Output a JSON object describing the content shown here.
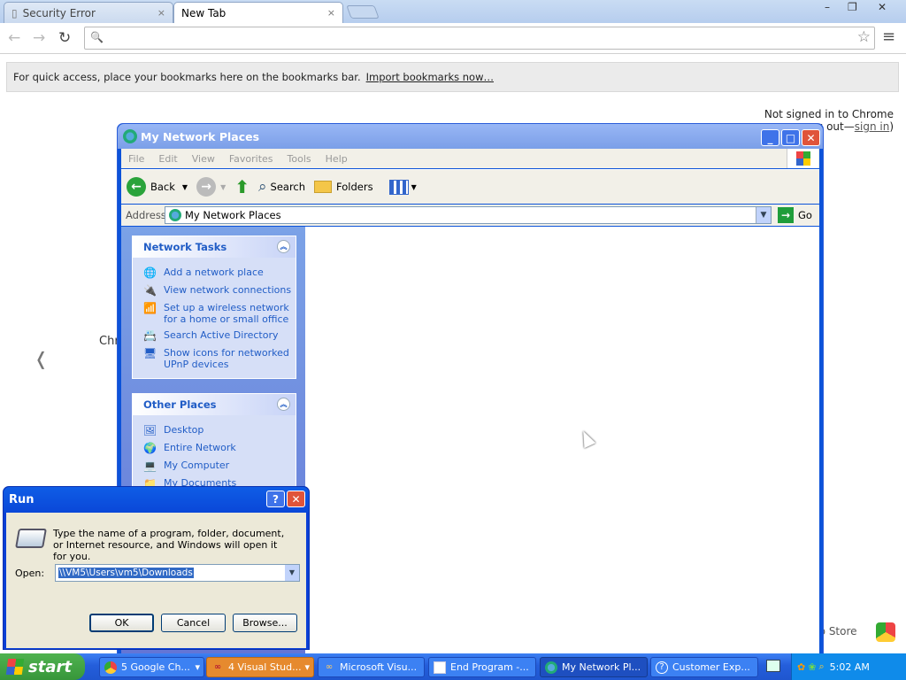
{
  "chrome": {
    "tabs": [
      {
        "title": "Security Error",
        "close": "×"
      },
      {
        "title": "New Tab",
        "close": "×"
      }
    ],
    "window_controls": [
      "–",
      "❐",
      "✕"
    ],
    "nav": {
      "back": "←",
      "forward": "→",
      "reload": "↻"
    },
    "omnibox": {
      "value": "",
      "search_glyph": "🔍",
      "star": "☆",
      "menu": "≡"
    },
    "bookmark_bar": {
      "text": "For quick access, place your bookmarks here on the bookmarks bar.",
      "link": "Import bookmarks now…"
    },
    "signin": {
      "line1": "Not signed in to Chrome",
      "line2_prefix": "g out—",
      "link": "sign in",
      "line2_suffix": ")"
    },
    "partial_text": "Chr",
    "chevron": "❬",
    "webstore": "eb Store"
  },
  "explorer": {
    "title": "My Network Places",
    "title_buttons": {
      "minimize": "_",
      "maximize": "□",
      "close": "✕"
    },
    "menu": [
      "File",
      "Edit",
      "View",
      "Favorites",
      "Tools",
      "Help"
    ],
    "toolbar": {
      "back": "Back",
      "search": "Search",
      "folders": "Folders"
    },
    "address": {
      "label": "Address",
      "value": "My Network Places",
      "go": "Go"
    },
    "network_tasks": {
      "title": "Network Tasks",
      "items": [
        {
          "line1": "Add a network place",
          "line2": ""
        },
        {
          "line1": "View network connections",
          "line2": ""
        },
        {
          "line1": "Set up a wireless network",
          "line2": "for a home or small office"
        },
        {
          "line1": "Search Active Directory",
          "line2": ""
        },
        {
          "line1": "Show icons for networked",
          "line2": "UPnP devices"
        }
      ]
    },
    "other_places": {
      "title": "Other Places",
      "items": [
        "Desktop",
        "Entire Network",
        "My Computer",
        "My Documents"
      ]
    }
  },
  "run_dialog": {
    "title": "Run",
    "help": "?",
    "close": "✕",
    "description": "Type the name of a program, folder, document, or Internet resource, and Windows will open it for you.",
    "open_label": "Open:",
    "open_value": "\\\\VM5\\Users\\vm5\\Downloads",
    "buttons": {
      "ok": "OK",
      "cancel": "Cancel",
      "browse": "Browse..."
    }
  },
  "taskbar": {
    "start": "start",
    "items": [
      {
        "label": "5 Google Ch...",
        "dropdown": "▾"
      },
      {
        "label": "4 Visual Stud...",
        "dropdown": "▾"
      },
      {
        "label": "Microsoft Visu..."
      },
      {
        "label": "End Program -..."
      },
      {
        "label": "My Network Pl..."
      },
      {
        "label": "Customer Exp..."
      }
    ],
    "clock": "5:02 AM"
  },
  "colors": {
    "xp_blue": "#0a3fd6",
    "taskbar_blue": "#245edb",
    "start_green": "#37963a",
    "task_link": "#215dc6"
  }
}
